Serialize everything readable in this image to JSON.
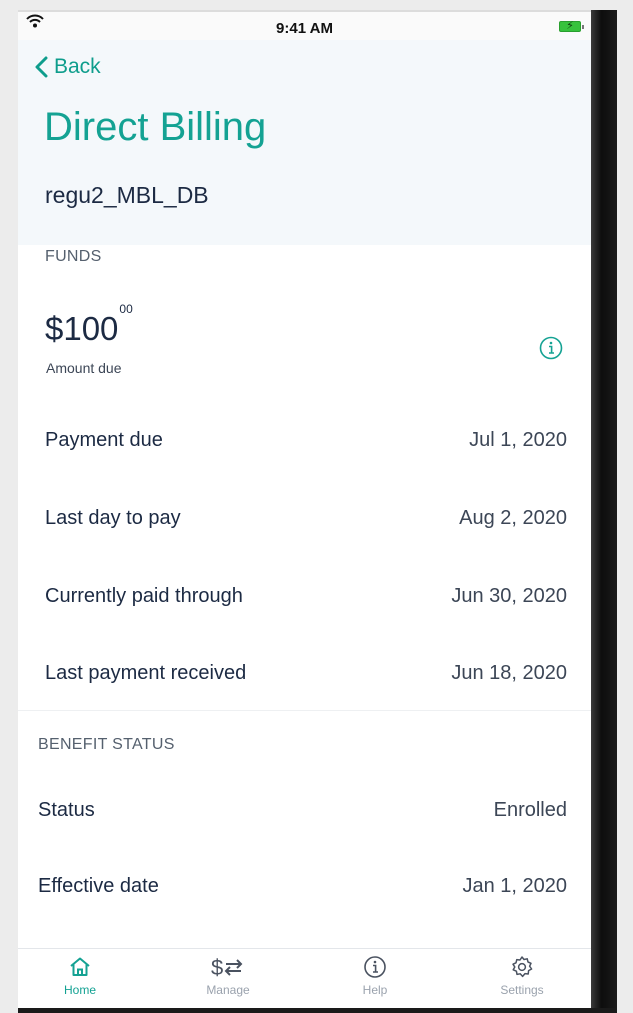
{
  "status_bar": {
    "time": "9:41 AM"
  },
  "nav": {
    "back_label": "Back"
  },
  "page": {
    "title": "Direct Billing",
    "account": "regu2_MBL_DB"
  },
  "funds": {
    "section_label": "FUNDS",
    "amount_dollars": "$100",
    "amount_cents": "00",
    "amount_label": "Amount due",
    "rows": [
      {
        "label": "Payment due",
        "value": "Jul 1, 2020"
      },
      {
        "label": "Last day to pay",
        "value": "Aug 2, 2020"
      },
      {
        "label": "Currently paid through",
        "value": "Jun 30, 2020"
      },
      {
        "label": "Last payment received",
        "value": "Jun 18, 2020"
      }
    ]
  },
  "benefit": {
    "section_label": "BENEFIT STATUS",
    "rows": [
      {
        "label": "Status",
        "value": "Enrolled"
      },
      {
        "label": "Effective date",
        "value": "Jan 1, 2020"
      }
    ]
  },
  "tabs": [
    {
      "label": "Home",
      "icon": "home-icon"
    },
    {
      "label": "Manage",
      "icon": "dollar-transfer-icon"
    },
    {
      "label": "Help",
      "icon": "info-icon"
    },
    {
      "label": "Settings",
      "icon": "gear-icon"
    }
  ],
  "colors": {
    "accent": "#14a293",
    "text_dark": "#1c2a43"
  }
}
